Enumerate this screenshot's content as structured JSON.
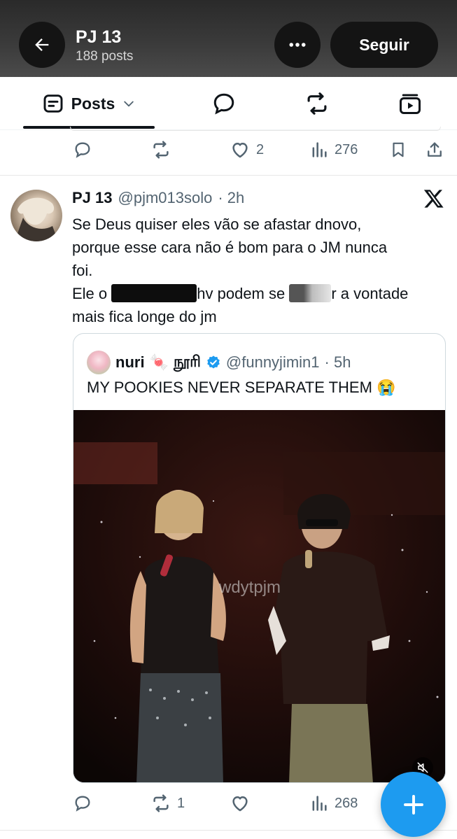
{
  "header": {
    "name": "PJ 13",
    "post_count": "188 posts",
    "follow_label": "Seguir",
    "back_icon": "arrow-left-icon",
    "more_icon": "more-horizontal-icon"
  },
  "tabs": {
    "active_label": "Posts",
    "items": [
      "posts-tab",
      "replies-tab",
      "reposts-tab",
      "media-tab"
    ]
  },
  "prev_post_actions": {
    "reply_count": "",
    "repost_count": "",
    "like_count": "2",
    "view_count": "276"
  },
  "post": {
    "author_name": "PJ 13",
    "author_handle": "@pjm013solo",
    "time": "· 2h",
    "line1": "Se Deus quiser eles vão se afastar dnovo,",
    "line2": "porque esse cara não é bom para o JM nunca",
    "line3": "foi.",
    "line4a": "Ele o ",
    "line4b": "hv podem se ",
    "line4c": "r a vontade",
    "line5": "mais fica longe do jm",
    "quote": {
      "author_name": "nuri",
      "name_emoji": "🍬",
      "name_tamil": "நூரி",
      "handle": "@funnyjimin1",
      "time": "· 5h",
      "text": "MY POOKIES NEVER SEPARATE THEM 😭",
      "watermark": "wdytpjm"
    },
    "actions": {
      "reply_count": "",
      "repost_count": "1",
      "like_count": "",
      "view_count": "268"
    }
  },
  "colors": {
    "accent": "#1d9bf0",
    "text_primary": "#0f1419",
    "text_secondary": "#536471",
    "verified": "#1d9bf0"
  }
}
